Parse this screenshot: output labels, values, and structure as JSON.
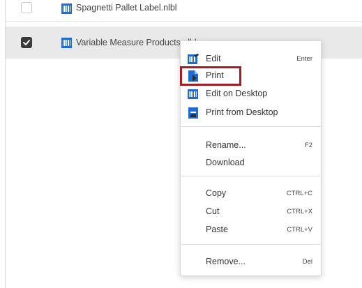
{
  "files": [
    {
      "name": "Spagnetti Pallet Label.nlbl",
      "checked": false
    },
    {
      "name": "Variable Measure Products.nlbl",
      "checked": true
    }
  ],
  "context_menu": {
    "items": [
      {
        "label": "Edit",
        "shortcut": "Enter",
        "icon": "label-edit-icon"
      },
      {
        "label": "Print",
        "shortcut": "",
        "icon": "print-doc-icon"
      },
      {
        "label": "Edit on Desktop",
        "shortcut": "",
        "icon": "barcode-icon"
      },
      {
        "label": "Print from Desktop",
        "shortcut": "",
        "icon": "print-desktop-icon"
      },
      {
        "label": "Rename...",
        "shortcut": "F2"
      },
      {
        "label": "Download",
        "shortcut": ""
      },
      {
        "label": "Copy",
        "shortcut": "CTRL+C"
      },
      {
        "label": "Cut",
        "shortcut": "CTRL+X"
      },
      {
        "label": "Paste",
        "shortcut": "CTRL+V"
      },
      {
        "label": "Remove...",
        "shortcut": "Del"
      }
    ],
    "highlighted_item": "Print",
    "highlight_color": "#a51c24"
  },
  "colors": {
    "accent": "#1565c0",
    "selected_row": "#e9e9e9"
  }
}
